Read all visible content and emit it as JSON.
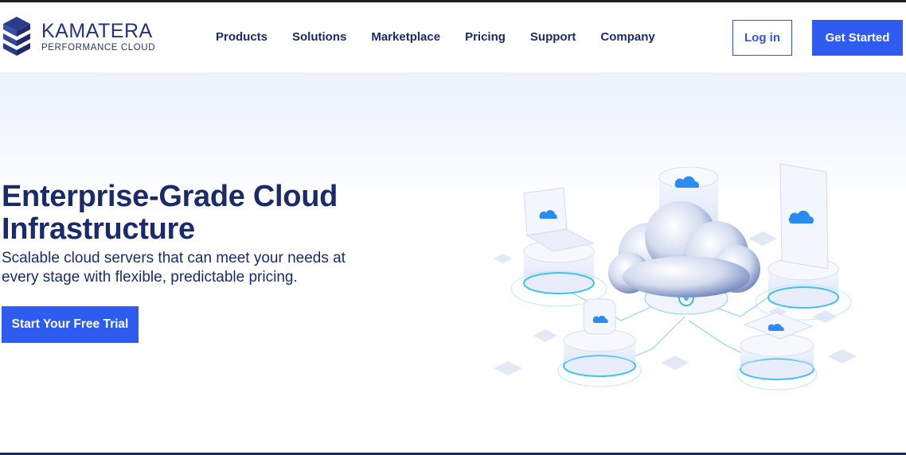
{
  "brand": {
    "name": "KAMATERA",
    "tagline": "PERFORMANCE CLOUD",
    "logo_icon": "kamatera-hexagon-logo"
  },
  "nav": {
    "items": [
      {
        "label": "Products"
      },
      {
        "label": "Solutions"
      },
      {
        "label": "Marketplace"
      },
      {
        "label": "Pricing"
      },
      {
        "label": "Support"
      },
      {
        "label": "Company"
      }
    ],
    "login_label": "Log in",
    "cta_label": "Get Started"
  },
  "hero": {
    "title": "Enterprise-Grade Cloud Infrastructure",
    "subtitle": "Scalable cloud servers that can meet your needs at every stage with flexible, predictable pricing.",
    "cta_label": "Start Your Free Trial",
    "illustration": "isometric-cloud-network-illustration"
  },
  "colors": {
    "brand_navy": "#1a2b6b",
    "accent_blue": "#2f5cf0",
    "hero_tint": "#edf1fd"
  }
}
